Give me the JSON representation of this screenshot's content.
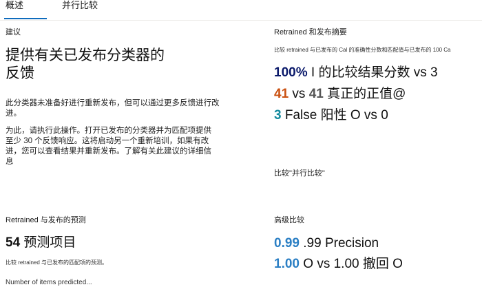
{
  "tabs": {
    "overview": "概述",
    "side_by_side": "并行比较"
  },
  "recommendation": {
    "title": "建议",
    "heading": "提供有关已发布分类器的反馈",
    "p1": "此分类器未准备好进行重新发布，但可以通过更多反馈进行改进。",
    "p2": "为此，请执行此操作。打开已发布的分类器并为匹配项提供至少 30 个反馈响应。这将启动另一个重新培训，如果有改进，您可以查看结果并重新发布。了解有关此建议的详细信息"
  },
  "summary": {
    "title": "Retrained 和发布摘要",
    "subtitle": "比较 retrained 与已发布的 Cal 的准确性分数和匹配值与已发布的 100 Ca",
    "line1": {
      "num": "100%",
      "text": " I 的比较结果分数 vs 3"
    },
    "line2": {
      "num_a": "41",
      "vs": " vs ",
      "num_b": "41",
      "text": " 真正的正值@"
    },
    "line3": {
      "num": "3",
      "text": " False 阳性 O vs 0"
    },
    "link": "比较\"并行比较\""
  },
  "predictions": {
    "title": "Retrained 与发布的预测",
    "count": "54",
    "label": " 预测项目",
    "subtitle": "比较 retrained 与已发布的匹配项的预测。",
    "cut": "Number of items predicted..."
  },
  "advanced": {
    "title": "高级比较",
    "line1": {
      "num": "0.99",
      "text": " .99 Precision"
    },
    "line2": {
      "num": "1.00",
      "text": " O vs 1.00 撤回 O"
    }
  },
  "colors": {
    "accent": "#0f6cbd",
    "navy": "#0b1a6b",
    "orange": "#ca5010",
    "teal": "#138a9e",
    "blue": "#2b7fc4"
  }
}
